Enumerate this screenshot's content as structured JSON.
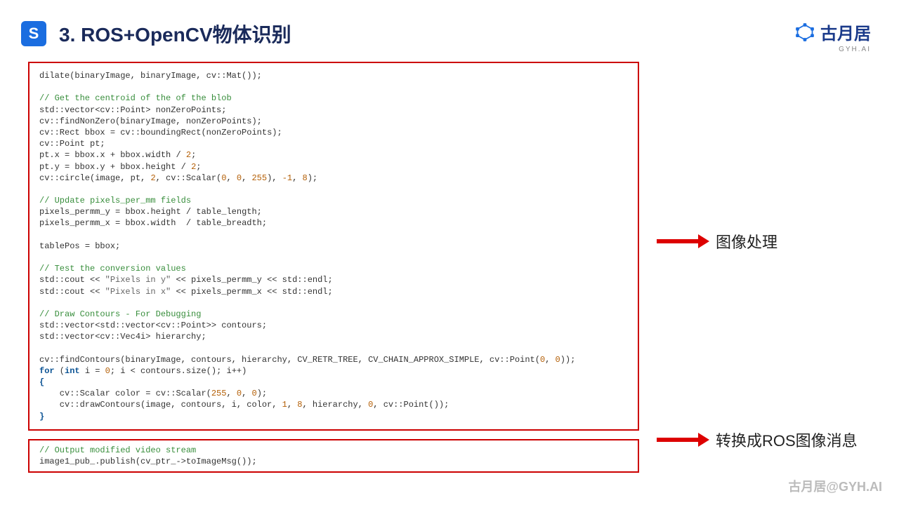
{
  "header": {
    "logo_letter": "S",
    "title": "3. ROS+OpenCV物体识别"
  },
  "brand": {
    "name": "古月居",
    "sub": "GYH.AI"
  },
  "annotations": {
    "label1": "图像处理",
    "label2": "转换成ROS图像消息"
  },
  "watermark": "古月居@GYH.AI",
  "code_block_1": {
    "l01": "dilate(binaryImage, binaryImage, cv::Mat());",
    "l02": "",
    "c03": "// Get the centroid of the of the blob",
    "l04a": "std::vector<cv::Point> nonZeroPoints;",
    "l05": "cv::findNonZero(binaryImage, nonZeroPoints);",
    "l06a": "cv::Rect bbox ",
    "l06b": "=",
    "l06c": " cv::boundingRect(nonZeroPoints);",
    "l07": "cv::Point pt;",
    "l08a": "pt.x ",
    "l08b": "=",
    "l08c": " bbox.x ",
    "l08d": "+",
    "l08e": " bbox.width ",
    "l08f": "/",
    "l08g": " ",
    "l08h": "2",
    "l08i": ";",
    "l09a": "pt.y ",
    "l09b": "=",
    "l09c": " bbox.y ",
    "l09d": "+",
    "l09e": " bbox.height ",
    "l09f": "/",
    "l09g": " ",
    "l09h": "2",
    "l09i": ";",
    "l10a": "cv::circle(image, pt, ",
    "l10b": "2",
    "l10c": ", cv::Scalar(",
    "l10d": "0",
    "l10e": ", ",
    "l10f": "0",
    "l10g": ", ",
    "l10h": "255",
    "l10i": "), ",
    "l10j": "-1",
    "l10k": ", ",
    "l10l": "8",
    "l10m": ");",
    "c11": "// Update pixels_per_mm fields",
    "l12a": "pixels_permm_y ",
    "l12b": "=",
    "l12c": " bbox.height ",
    "l12d": "/",
    "l12e": " table_length;",
    "l13a": "pixels_permm_x ",
    "l13b": "=",
    "l13c": " bbox.width  ",
    "l13d": "/",
    "l13e": " table_breadth;",
    "l14a": "tablePos ",
    "l14b": "=",
    "l14c": " bbox;",
    "c15": "// Test the conversion values",
    "l16a": "std::cout ",
    "l16b": "<<",
    "l16c": " ",
    "l16d": "\"Pixels in y\"",
    "l16e": " ",
    "l16f": "<<",
    "l16g": " pixels_permm_y ",
    "l16h": "<<",
    "l16i": " std::endl;",
    "l17a": "std::cout ",
    "l17b": "<<",
    "l17c": " ",
    "l17d": "\"Pixels in x\"",
    "l17e": " ",
    "l17f": "<<",
    "l17g": " pixels_permm_x ",
    "l17h": "<<",
    "l17i": " std::endl;",
    "c18": "// Draw Contours - For Debugging",
    "l19": "std::vector<std::vector<cv::Point>> contours;",
    "l20": "std::vector<cv::Vec4i> hierarchy;",
    "l21a": "cv::findContours(binaryImage, contours, hierarchy, CV_RETR_TREE, CV_CHAIN_APPROX_SIMPLE, cv::Point(",
    "l21b": "0",
    "l21c": ", ",
    "l21d": "0",
    "l21e": "));",
    "l22a": "for",
    "l22b": " (",
    "l22c": "int",
    "l22d": " i ",
    "l22e": "=",
    "l22f": " ",
    "l22g": "0",
    "l22h": "; i ",
    "l22i": "<",
    "l22j": " contours.size(); i",
    "l22k": "++",
    "l22l": ")",
    "l23": "{",
    "l24a": "    cv::Scalar color ",
    "l24b": "=",
    "l24c": " cv::Scalar(",
    "l24d": "255",
    "l24e": ", ",
    "l24f": "0",
    "l24g": ", ",
    "l24h": "0",
    "l24i": ");",
    "l25a": "    cv::drawContours(image, contours, i, color, ",
    "l25b": "1",
    "l25c": ", ",
    "l25d": "8",
    "l25e": ", hierarchy, ",
    "l25f": "0",
    "l25g": ", cv::Point());",
    "l26": "}"
  },
  "code_block_2": {
    "c1": "// Output modified video stream",
    "l2a": "image1_pub_.publish(cv_ptr_",
    "l2b": "->",
    "l2c": "toImageMsg());"
  }
}
